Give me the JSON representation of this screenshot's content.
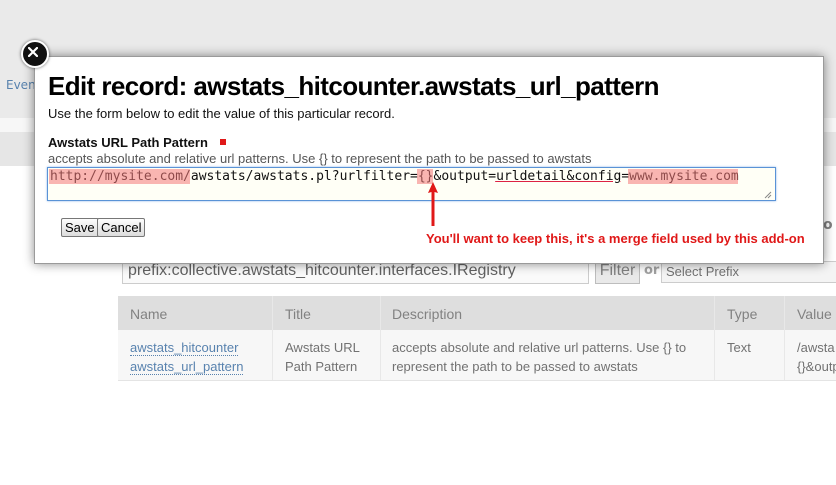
{
  "background": {
    "tab_label": "Even",
    "right_fragment": "o",
    "search_value": "prefix:collective.awstats_hitcounter.interfaces.IRegistry",
    "filter_label": "Filter",
    "or_label": "or",
    "select_placeholder": "Select Prefix",
    "table": {
      "headers": [
        "Name",
        "Title",
        "Description",
        "Type",
        "Value"
      ],
      "row": {
        "name_line1": "awstats_hitcounter",
        "name_line2": "awstats_url_pattern",
        "title_line1": "Awstats URL",
        "title_line2": "Path Pattern",
        "description_line1": "accepts absolute and relative url patterns. Use {} to",
        "description_line2": "represent the path to be passed to awstats",
        "type": "Text",
        "value_line1": "/awsta",
        "value_line2": "{}&outp"
      }
    }
  },
  "modal": {
    "title": "Edit record: awstats_hitcounter.awstats_url_pattern",
    "description": "Use the form below to edit the value of this particular record.",
    "field": {
      "label": "Awstats URL Path Pattern",
      "help": "accepts absolute and relative url patterns. Use {} to represent the path to be passed to awstats",
      "value": "http://mysite.com/awstats/awstats.pl?urlfilter={}&output=urldetail&config=www.mysite.com"
    },
    "buttons": {
      "save": "Save",
      "cancel": "Cancel"
    }
  },
  "annotation": {
    "text": "You'll want to keep this, it's a merge field used by this add-on",
    "color": "#e01818"
  },
  "highlight_segments": [
    {
      "text": "http://mysite.com/",
      "style": "hl"
    },
    {
      "text": "awstats/awstats.pl?urlfilter=",
      "style": "plain"
    },
    {
      "text": "{}",
      "style": "hl"
    },
    {
      "text": "&output=",
      "style": "plain"
    },
    {
      "text": "urldetail&config",
      "style": "ul"
    },
    {
      "text": "=",
      "style": "plain"
    },
    {
      "text": "www.mysite.com",
      "style": "hl"
    }
  ],
  "colors": {
    "accent_red": "#e01818",
    "link_blue": "#4a78a8",
    "focus_blue": "#5a93d6"
  }
}
